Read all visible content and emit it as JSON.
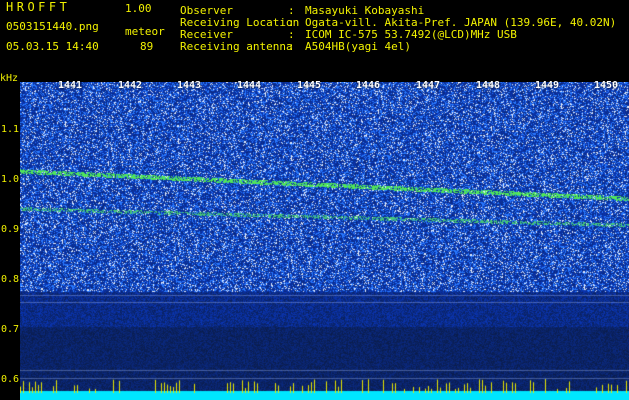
{
  "header": {
    "brand": "HROFFT",
    "version": "1.00",
    "filename": "0503151440.png",
    "timestamp": "05.03.15 14:40",
    "mode": "meteor",
    "count": "89"
  },
  "metadata": [
    {
      "label": "Observer",
      "value": "Masayuki Kobayashi"
    },
    {
      "label": "Receiving Location",
      "value": "Ogata-vill. Akita-Pref. JAPAN (139.96E, 40.02N)"
    },
    {
      "label": "Receiver",
      "value": "ICOM IC-575 53.7492(@LCD)MHz USB"
    },
    {
      "label": "Receiving antenna",
      "value": "A504HB(yagi 4el)"
    }
  ],
  "separator": ":",
  "axis": {
    "y_unit": "kHz",
    "y_ticks": [
      "1.1",
      "1.0",
      "0.9",
      "0.8",
      "0.7",
      "0.6"
    ],
    "x_ticks": [
      "1441",
      "1442",
      "1443",
      "1444",
      "1445",
      "1446",
      "1447",
      "1448",
      "1449",
      "1450"
    ]
  },
  "colors": {
    "label_yellow": "#f2f200",
    "spectrum_blue": "#1430c8",
    "signal_green": "#3cff3c",
    "baseline_cyan": "#00e6ff"
  }
}
